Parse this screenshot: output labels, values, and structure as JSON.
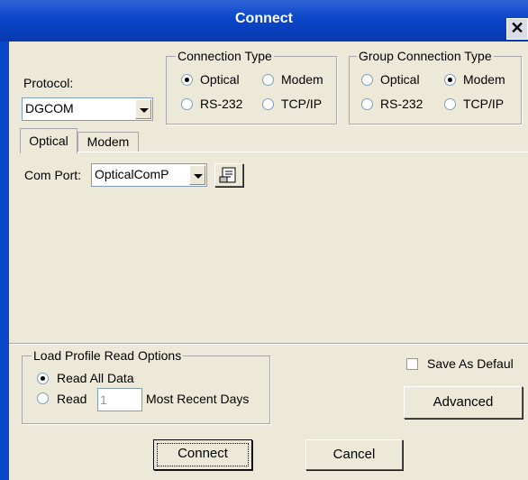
{
  "window": {
    "title": "Connect",
    "close_label": "✕"
  },
  "protocol": {
    "label": "Protocol:",
    "value": "DGCOM"
  },
  "connection_type": {
    "legend": "Connection Type",
    "options": [
      "Optical",
      "Modem",
      "RS-232",
      "TCP/IP"
    ],
    "selected": "Optical"
  },
  "group_connection_type": {
    "legend": "Group Connection Type",
    "options": [
      "Optical",
      "Modem",
      "RS-232",
      "TCP/IP"
    ],
    "selected": "Modem"
  },
  "tabs": [
    {
      "label": "Optical",
      "active": true
    },
    {
      "label": "Modem",
      "active": false
    }
  ],
  "com_port": {
    "label": "Com Port:",
    "value": "OpticalComP"
  },
  "load_profile": {
    "legend": "Load Profile Read Options",
    "read_all_label": "Read All Data",
    "read_label": "Read",
    "days_value": "1",
    "recent_days_label": "Most Recent Days",
    "selected": "Read All Data"
  },
  "save_as_default": {
    "label": "Save As Defaul",
    "checked": false
  },
  "buttons": {
    "advanced": "Advanced",
    "connect": "Connect",
    "cancel": "Cancel"
  }
}
